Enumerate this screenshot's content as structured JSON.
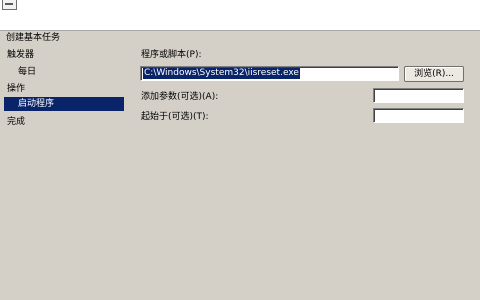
{
  "wizard": {
    "title": "创建基本任务"
  },
  "nav": {
    "items": [
      {
        "label": "触发器",
        "indent": false,
        "selected": false
      },
      {
        "label": "每日",
        "indent": true,
        "selected": false
      },
      {
        "label": "操作",
        "indent": false,
        "selected": false
      },
      {
        "label": "启动程序",
        "indent": true,
        "selected": true
      },
      {
        "label": "完成",
        "indent": false,
        "selected": false
      }
    ]
  },
  "form": {
    "program_label": "程序或脚本(P):",
    "program_value": "C:\\Windows\\System32\\iisreset.exe",
    "browse_label": "浏览(R)...",
    "args_label": "添加参数(可选)(A):",
    "args_value": "",
    "start_label": "起始于(可选)(T):",
    "start_value": ""
  },
  "colors": {
    "selection": "#0a246a",
    "background": "#d4d0c8"
  }
}
